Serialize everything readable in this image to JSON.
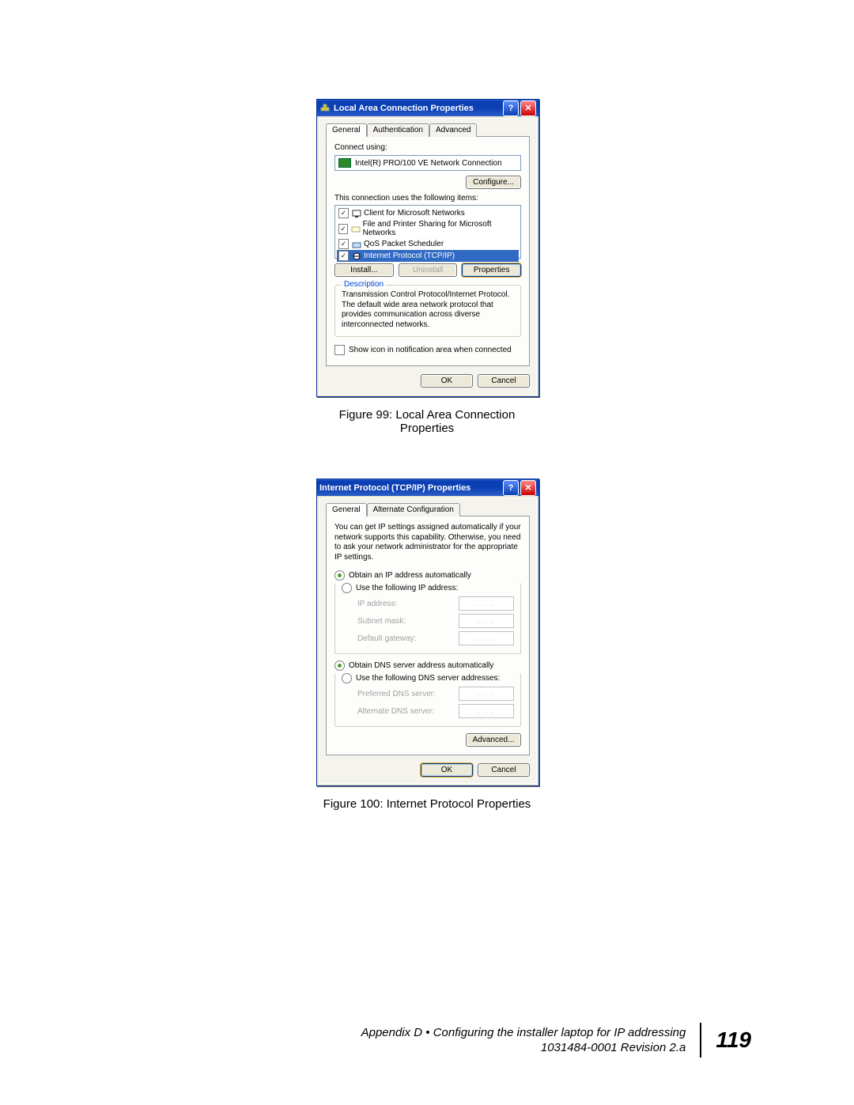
{
  "figure1": {
    "caption": "Figure 99:  Local Area Connection Properties",
    "dialog": {
      "title": "Local Area Connection Properties",
      "tabs": [
        "General",
        "Authentication",
        "Advanced"
      ],
      "connect_using_label": "Connect using:",
      "adapter": "Intel(R) PRO/100 VE Network Connection",
      "configure_btn": "Configure...",
      "items_label": "This connection uses the following items:",
      "items": [
        "Client for Microsoft Networks",
        "File and Printer Sharing for Microsoft Networks",
        "QoS Packet Scheduler",
        "Internet Protocol (TCP/IP)"
      ],
      "install_btn": "Install...",
      "uninstall_btn": "Uninstall",
      "properties_btn": "Properties",
      "description_legend": "Description",
      "description_text": "Transmission Control Protocol/Internet Protocol. The default wide area network protocol that provides communication across diverse interconnected networks.",
      "show_icon_label": "Show icon in notification area when connected",
      "ok_btn": "OK",
      "cancel_btn": "Cancel"
    }
  },
  "figure2": {
    "caption": "Figure 100:  Internet Protocol Properties",
    "dialog": {
      "title": "Internet Protocol (TCP/IP) Properties",
      "tabs": [
        "General",
        "Alternate Configuration"
      ],
      "intro_text": "You can get IP settings assigned automatically if your network supports this capability. Otherwise, you need to ask your network administrator for the appropriate IP settings.",
      "radio_auto_ip": "Obtain an IP address automatically",
      "radio_use_ip": "Use the following IP address:",
      "ip_address_lbl": "IP address:",
      "subnet_lbl": "Subnet mask:",
      "gateway_lbl": "Default gateway:",
      "radio_auto_dns": "Obtain DNS server address automatically",
      "radio_use_dns": "Use the following DNS server addresses:",
      "pref_dns_lbl": "Preferred DNS server:",
      "alt_dns_lbl": "Alternate DNS server:",
      "advanced_btn": "Advanced...",
      "ok_btn": "OK",
      "cancel_btn": "Cancel"
    }
  },
  "footer": {
    "line1": "Appendix D • Configuring the installer laptop for IP addressing",
    "line2": "1031484-0001  Revision 2.a",
    "page": "119"
  }
}
